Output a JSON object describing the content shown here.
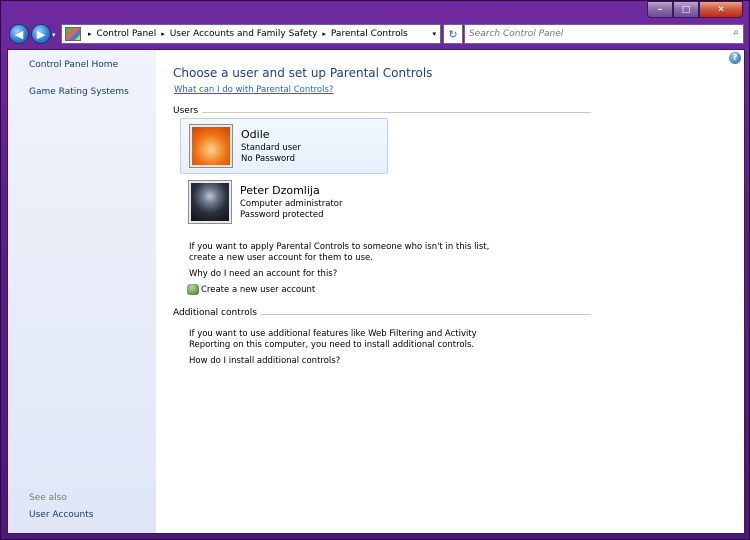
{
  "window": {
    "minimize_glyph": "–",
    "maximize_glyph": "□",
    "close_glyph": "✕"
  },
  "nav": {
    "back_glyph": "◀",
    "forward_glyph": "▶",
    "dropdown_glyph": "▾",
    "refresh_glyph": "↻"
  },
  "address": {
    "breadcrumbs": [
      "Control Panel",
      "User Accounts and Family Safety",
      "Parental Controls"
    ],
    "separator": "▸"
  },
  "search": {
    "placeholder": "Search Control Panel",
    "icon": "magnifier-icon",
    "glyph": "⌕"
  },
  "sidebar": {
    "items": [
      {
        "label": "Control Panel Home"
      },
      {
        "label": "Game Rating Systems"
      }
    ],
    "see_also_label": "See also",
    "see_also_items": [
      {
        "label": "User Accounts"
      }
    ]
  },
  "main": {
    "help_glyph": "?",
    "title": "Choose a user and set up Parental Controls",
    "what_can_i_do_link": "What can I do with Parental Controls?",
    "users_section_label": "Users",
    "users": [
      {
        "name": "Odile",
        "type": "Standard user",
        "password": "No Password",
        "avatar": "flower"
      },
      {
        "name": "Peter Dzomlija",
        "type": "Computer administrator",
        "password": "Password protected",
        "avatar": "dark-figure"
      }
    ],
    "no_account_text_1": "If you want to apply Parental Controls to someone who isn't in this list,",
    "no_account_text_2": "create a new user account for them to use.",
    "why_link": "Why do I need an account for this?",
    "create_link": "Create a new user account",
    "additional_section_label": "Additional controls",
    "additional_text_1": "If you want to use additional features like Web Filtering and Activity",
    "additional_text_2": "Reporting on this computer, you need to install additional controls.",
    "install_link": "How do I install additional controls?"
  },
  "colors": {
    "frame": "#5a1f8a",
    "heading": "#1e3f8a",
    "link": "#1b6ac9",
    "sidebar_bg": "#e6ebf8"
  }
}
